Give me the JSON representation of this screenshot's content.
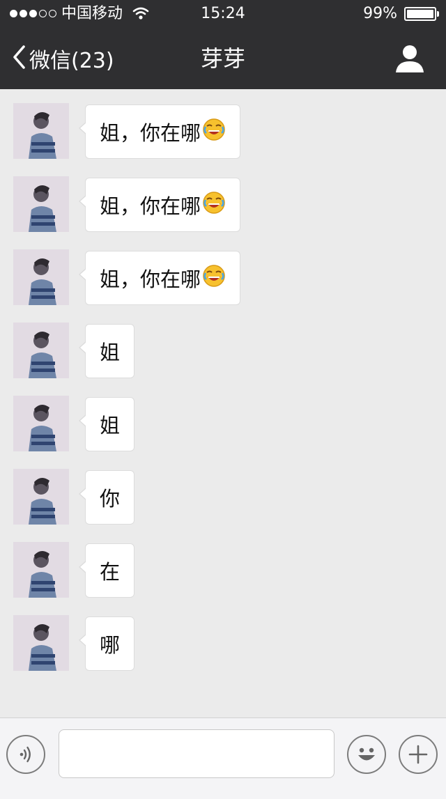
{
  "status_bar": {
    "carrier": "中国移动",
    "time": "15:24",
    "battery": "99%"
  },
  "nav": {
    "back_label": "微信(23)",
    "title": "芽芽"
  },
  "messages": [
    {
      "text": "姐，你在哪",
      "emoji": "laughing-crying-emoji"
    },
    {
      "text": "姐，你在哪",
      "emoji": "laughing-crying-emoji"
    },
    {
      "text": "姐，你在哪",
      "emoji": "laughing-crying-emoji"
    },
    {
      "text": "姐"
    },
    {
      "text": "姐"
    },
    {
      "text": "你"
    },
    {
      "text": "在"
    },
    {
      "text": "哪"
    }
  ],
  "input": {
    "placeholder": "",
    "value": ""
  },
  "icons": {
    "back": "chevron-left-icon",
    "profile": "person-icon",
    "voice": "voice-icon",
    "emoji": "smiley-icon",
    "add": "plus-icon"
  },
  "colors": {
    "topbar": "#2f2f31",
    "background": "#ebebeb",
    "bubble": "#ffffff"
  }
}
